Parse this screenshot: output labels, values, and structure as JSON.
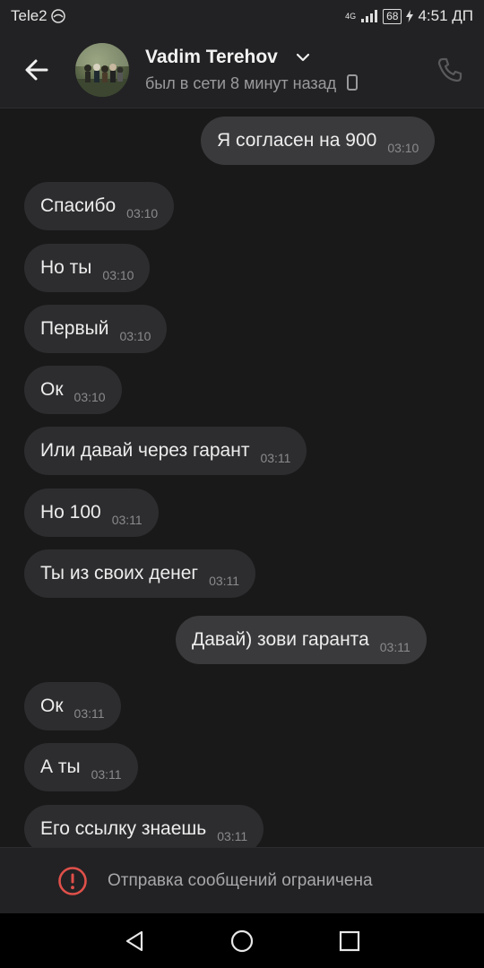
{
  "statusbar": {
    "carrier": "Tele2",
    "network": "4G",
    "battery": "68",
    "time": "4:51 ДП"
  },
  "header": {
    "contact_name": "Vadim Terehov",
    "status": "был в сети 8 минут назад"
  },
  "messages": [
    {
      "direction": "out",
      "text": "Я согласен на 900",
      "time": "03:10"
    },
    {
      "direction": "in",
      "text": "Спасибо",
      "time": "03:10"
    },
    {
      "direction": "in",
      "text": "Но ты",
      "time": "03:10"
    },
    {
      "direction": "in",
      "text": "Первый",
      "time": "03:10"
    },
    {
      "direction": "in",
      "text": "Ок",
      "time": "03:10"
    },
    {
      "direction": "in",
      "text": "Или давай через гарант",
      "time": "03:11"
    },
    {
      "direction": "in",
      "text": "Но 100",
      "time": "03:11"
    },
    {
      "direction": "in",
      "text": "Ты из своих денег",
      "time": "03:11"
    },
    {
      "direction": "out",
      "text": "Давай) зови гаранта",
      "time": "03:11"
    },
    {
      "direction": "in",
      "text": "Ок",
      "time": "03:11"
    },
    {
      "direction": "in",
      "text": "А ты",
      "time": "03:11"
    },
    {
      "direction": "in",
      "text": "Его ссылку знаешь",
      "time": "03:11"
    }
  ],
  "footer": {
    "restricted_text": "Отправка сообщений ограничена"
  },
  "colors": {
    "background": "#19191a",
    "bar": "#222224",
    "bubble_in": "#2d2d2f",
    "bubble_out": "#3a3a3c",
    "alert": "#e0504a"
  },
  "icons": {
    "back": "arrow-left-icon",
    "phone": "phone-icon",
    "alert": "alert-circle-icon",
    "nav_back": "triangle-back-icon",
    "nav_home": "circle-home-icon",
    "nav_recent": "square-recent-icon"
  }
}
